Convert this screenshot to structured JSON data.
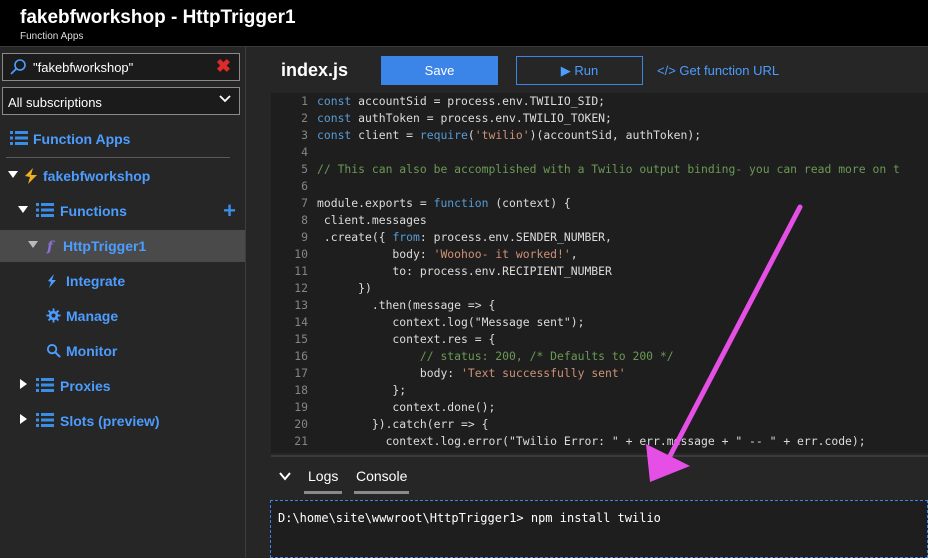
{
  "header": {
    "title": "fakebfworkshop - HttpTrigger1",
    "subtitle": "Function Apps"
  },
  "sidebar": {
    "search_value": "\"fakebfworkshop\"",
    "subscription": "All subscriptions",
    "items": [
      {
        "label": "Function Apps"
      },
      {
        "label": "fakebfworkshop"
      },
      {
        "label": "Functions"
      },
      {
        "label": "HttpTrigger1"
      },
      {
        "label": "Integrate"
      },
      {
        "label": "Manage"
      },
      {
        "label": "Monitor"
      },
      {
        "label": "Proxies"
      },
      {
        "label": "Slots (preview)"
      }
    ]
  },
  "editor": {
    "filename": "index.js",
    "save_label": "Save",
    "run_label": "▶ Run",
    "get_url_label": "</> Get function URL",
    "lines": [
      {
        "n": "1",
        "code": "const accountSid = process.env.TWILIO_SID;"
      },
      {
        "n": "2",
        "code": "const authToken = process.env.TWILIO_TOKEN;"
      },
      {
        "n": "3",
        "code": "const client = require('twilio')(accountSid, authToken);"
      },
      {
        "n": "4",
        "code": ""
      },
      {
        "n": "5",
        "code": "// This can also be accomplished with a Twilio output binding- you can read more on t"
      },
      {
        "n": "6",
        "code": ""
      },
      {
        "n": "7",
        "code": "module.exports = function (context) {"
      },
      {
        "n": "8",
        "code": " client.messages"
      },
      {
        "n": "9",
        "code": " .create({ from: process.env.SENDER_NUMBER,"
      },
      {
        "n": "10",
        "code": "           body: 'Woohoo- it worked!',"
      },
      {
        "n": "11",
        "code": "           to: process.env.RECIPIENT_NUMBER"
      },
      {
        "n": "12",
        "code": "      })"
      },
      {
        "n": "13",
        "code": "        .then(message => {"
      },
      {
        "n": "14",
        "code": "           context.log(\"Message sent\");"
      },
      {
        "n": "15",
        "code": "           context.res = {"
      },
      {
        "n": "16",
        "code": "               // status: 200, /* Defaults to 200 */"
      },
      {
        "n": "17",
        "code": "               body: 'Text successfully sent'"
      },
      {
        "n": "18",
        "code": "           };"
      },
      {
        "n": "19",
        "code": "           context.done();"
      },
      {
        "n": "20",
        "code": "        }).catch(err => {"
      },
      {
        "n": "21",
        "code": "          context.log.error(\"Twilio Error: \" + err.message + \" -- \" + err.code);"
      }
    ]
  },
  "panel": {
    "tabs": [
      {
        "label": "Logs"
      },
      {
        "label": "Console"
      }
    ],
    "console_text": "D:\\home\\site\\wwwroot\\HttpTrigger1> npm install twilio"
  },
  "colors": {
    "accent": "#3c85e8",
    "link": "#4c9dff",
    "annotation_arrow": "#e64fe6",
    "error_x": "#e02a2a"
  }
}
